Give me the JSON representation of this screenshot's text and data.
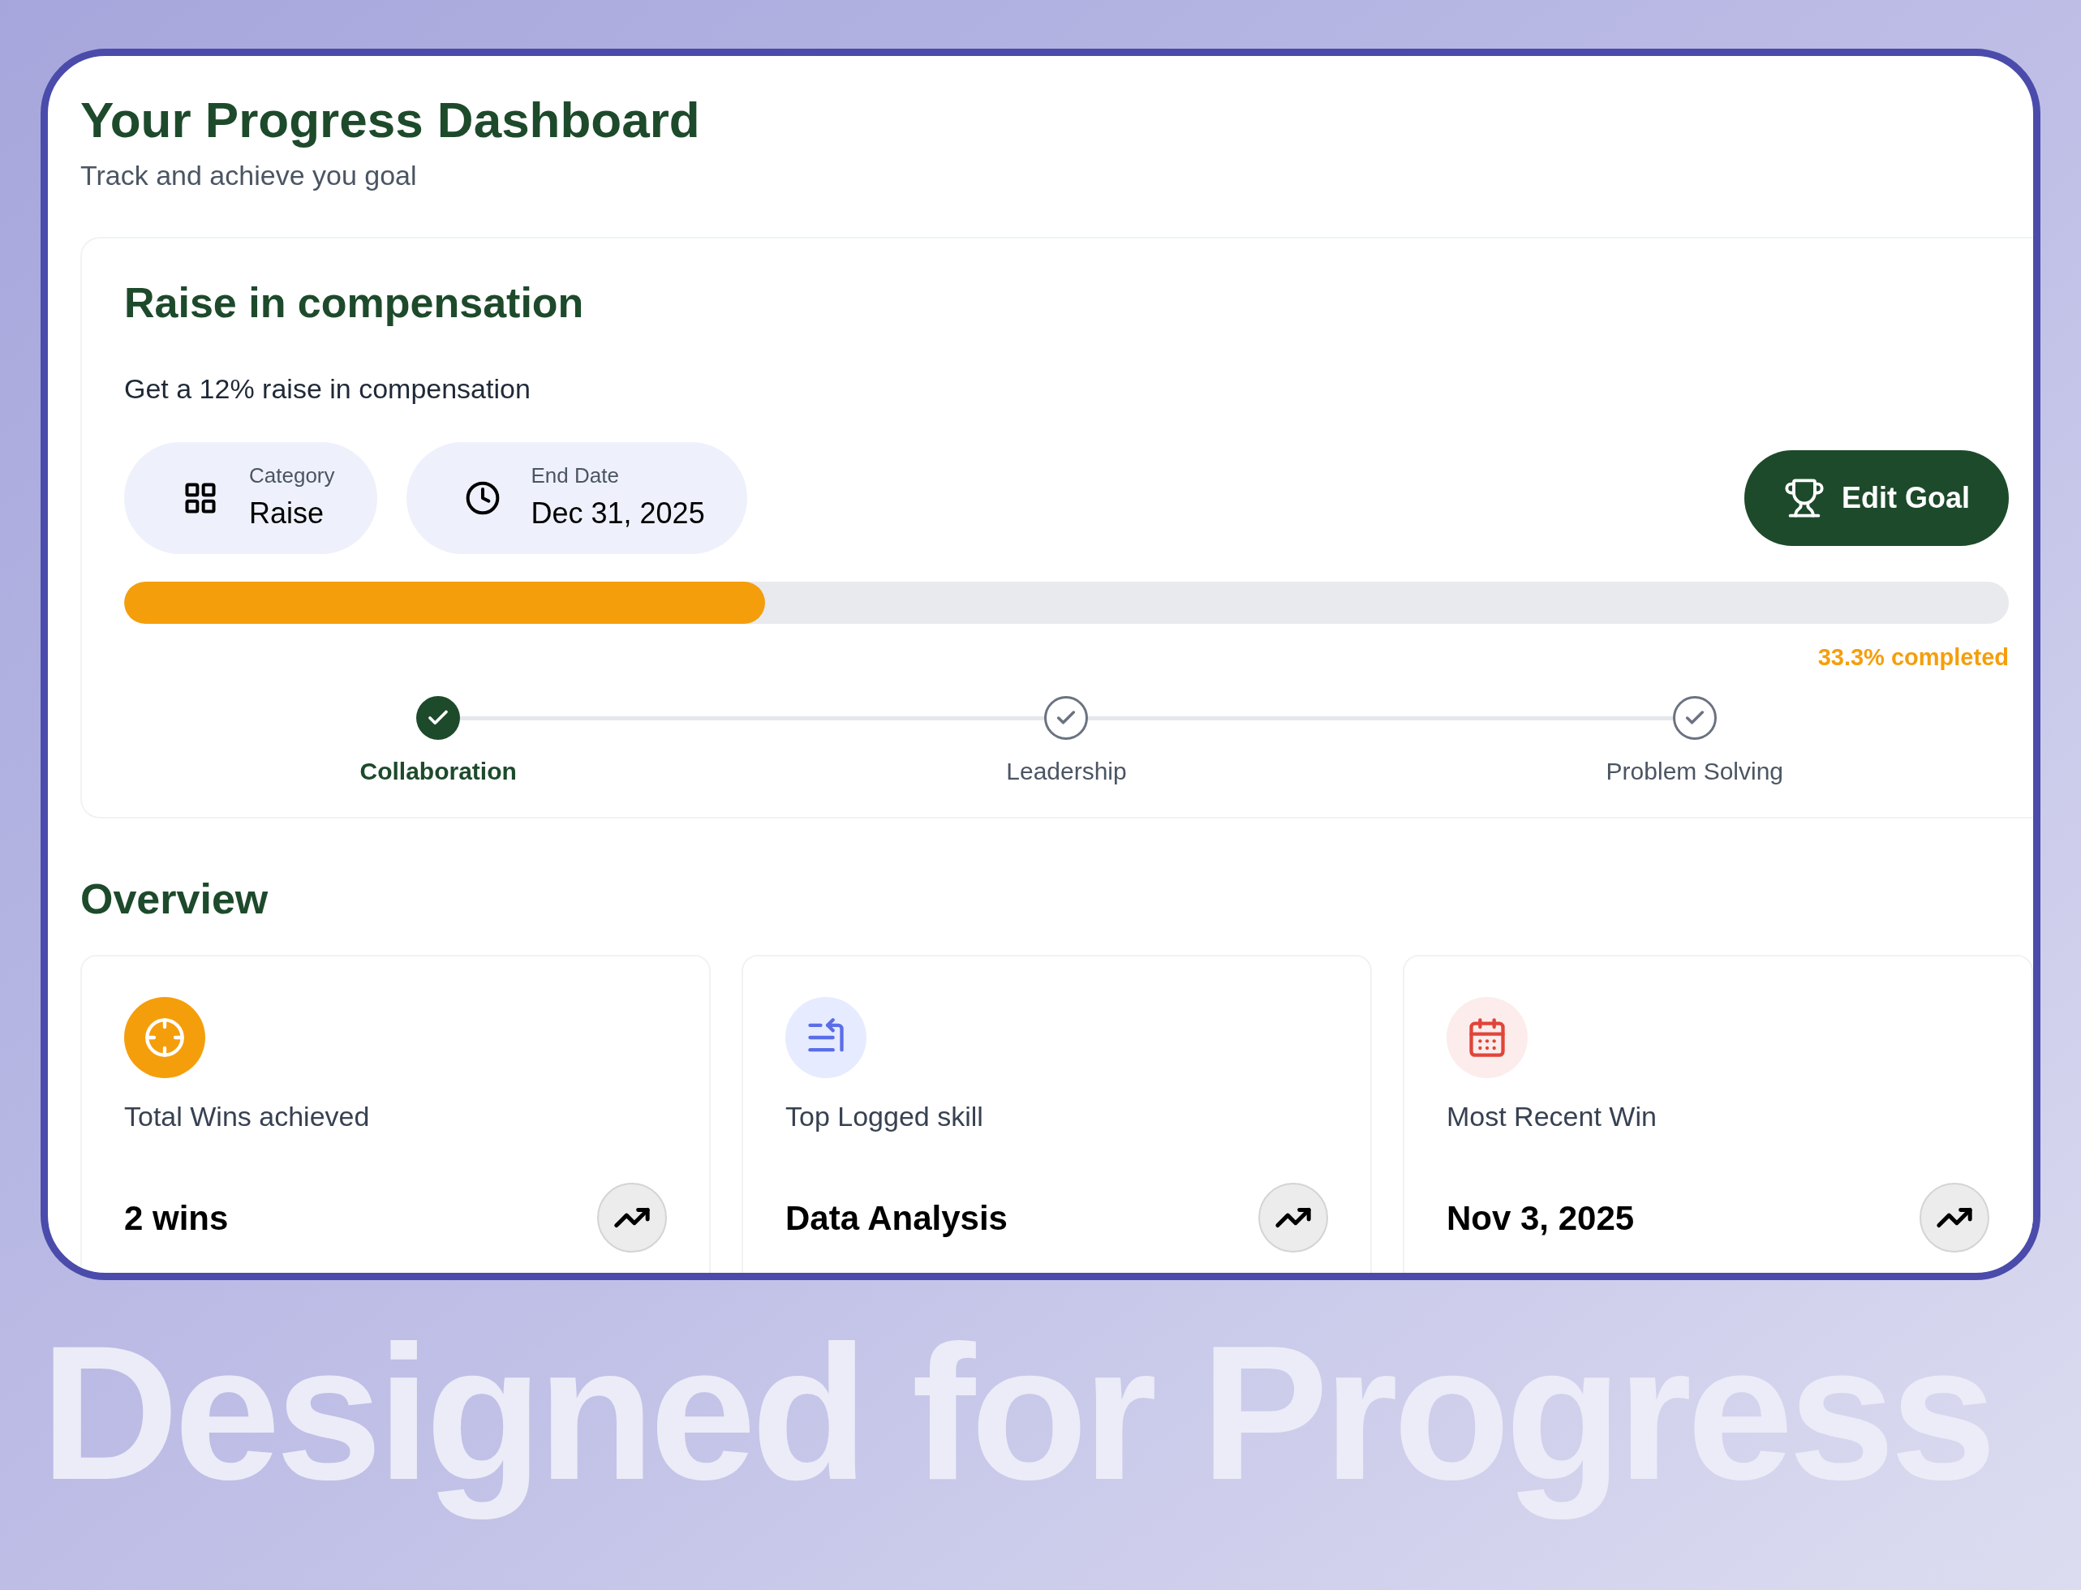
{
  "header": {
    "title": "Your Progress Dashboard",
    "subtitle": "Track and achieve you goal"
  },
  "goal": {
    "title": "Raise in compensation",
    "description": "Get a 12% raise in compensation",
    "chips": [
      {
        "kind": "category",
        "label": "Category",
        "value": "Raise"
      },
      {
        "kind": "date",
        "label": "End Date",
        "value": "Dec 31, 2025"
      }
    ],
    "edit_button": "Edit Goal",
    "progress": {
      "level": 0.34,
      "reading": "33.3% completed"
    },
    "milestones": [
      {
        "label": "Collaboration",
        "done": true
      },
      {
        "label": "Leadership",
        "done": false
      },
      {
        "label": "Problem Solving",
        "done": false
      }
    ]
  },
  "overview": {
    "title": "Overview",
    "cards": [
      {
        "kind": "target",
        "label": "Total Wins achieved",
        "value": "2 wins"
      },
      {
        "kind": "skill",
        "label": "Top Logged skill",
        "value": "Data Analysis"
      },
      {
        "kind": "calendar",
        "label": "Most Recent Win",
        "value": "Nov 3, 2025"
      }
    ]
  },
  "headline": "Designed for Progress"
}
